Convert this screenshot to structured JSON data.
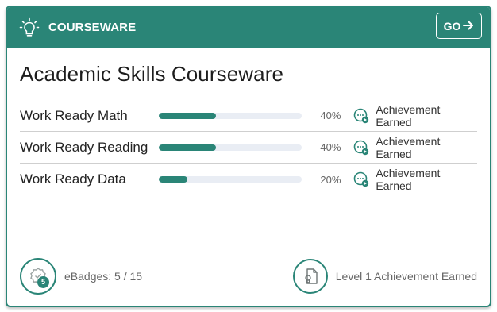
{
  "header": {
    "icon": "lightbulb-icon",
    "title": "COURSEWARE",
    "go_label": "GO",
    "go_icon": "arrow-right-icon"
  },
  "main": {
    "title": "Academic Skills Courseware",
    "courses": [
      {
        "name": "Work Ready Math",
        "progress": 40,
        "progress_label": "40%",
        "achievement_label": "Achievement Earned",
        "achievement_icon": "achievement-icon"
      },
      {
        "name": "Work Ready Reading",
        "progress": 40,
        "progress_label": "40%",
        "achievement_label": "Achievement Earned",
        "achievement_icon": "achievement-icon"
      },
      {
        "name": "Work Ready Data",
        "progress": 20,
        "progress_label": "20%",
        "achievement_label": "Achievement Earned",
        "achievement_icon": "achievement-icon"
      }
    ]
  },
  "footer": {
    "ebadges_icon": "badge-icon",
    "ebadges_count": "5",
    "ebadges_label": "eBadges: 5 / 15",
    "level_icon": "level-certificate-icon",
    "level_label": "Level 1 Achievement Earned"
  },
  "colors": {
    "accent": "#2a8577",
    "track": "#e9edf4"
  }
}
